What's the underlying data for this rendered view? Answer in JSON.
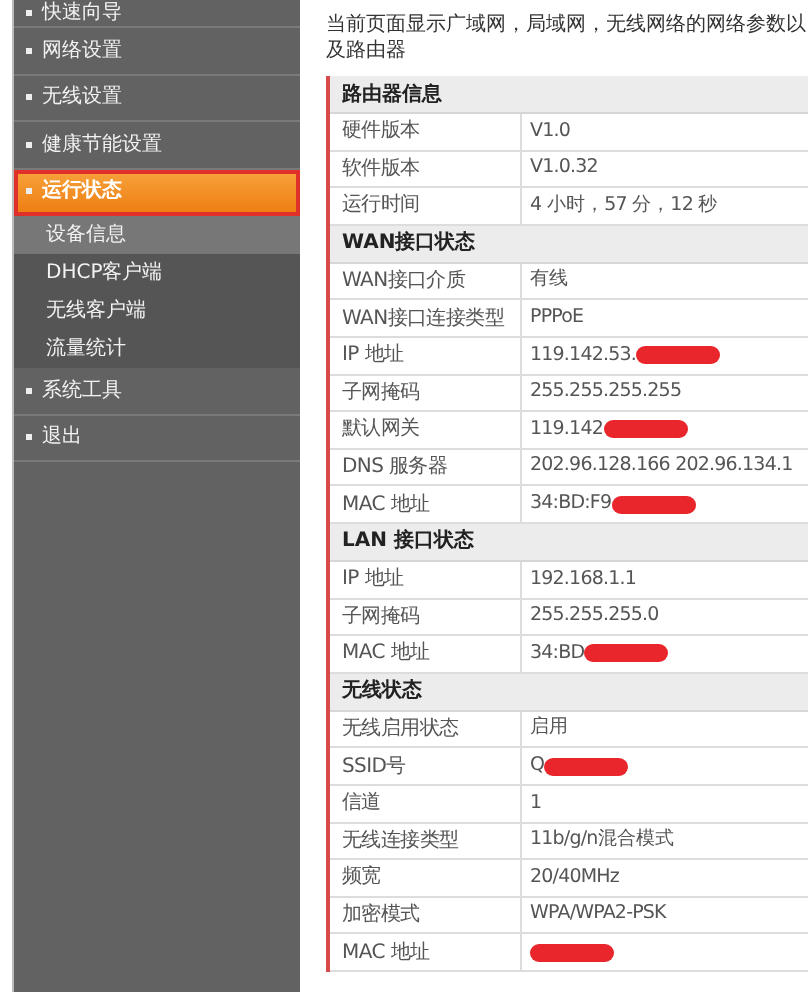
{
  "sidebar": {
    "items": [
      {
        "kind": "section",
        "label": "快速向导",
        "selected": false,
        "annotated": false
      },
      {
        "kind": "section",
        "label": "网络设置",
        "selected": false,
        "annotated": false
      },
      {
        "kind": "section",
        "label": "无线设置",
        "selected": false,
        "annotated": false
      },
      {
        "kind": "section",
        "label": "健康节能设置",
        "selected": false,
        "annotated": false
      },
      {
        "kind": "section",
        "label": "运行状态",
        "selected": true,
        "annotated": true
      },
      {
        "kind": "sub",
        "label": "设备信息",
        "selected": true,
        "annotated": false
      },
      {
        "kind": "sub",
        "label": "DHCP客户端",
        "selected": false,
        "annotated": false
      },
      {
        "kind": "sub",
        "label": "无线客户端",
        "selected": false,
        "annotated": false
      },
      {
        "kind": "sub",
        "label": "流量统计",
        "selected": false,
        "annotated": false
      },
      {
        "kind": "section",
        "label": "系统工具",
        "selected": false,
        "annotated": false
      },
      {
        "kind": "section",
        "label": "退出",
        "selected": false,
        "annotated": false
      }
    ]
  },
  "intro": "当前页面显示广域网，局域网，无线网络的网络参数以及路由器",
  "table": {
    "sections": [
      {
        "title": "路由器信息",
        "rows": [
          {
            "label": "硬件版本",
            "value": "V1.0",
            "redacted": false
          },
          {
            "label": "软件版本",
            "value": "V1.0.32",
            "redacted": false
          },
          {
            "label": "运行时间",
            "value": "4 小时，57 分，12 秒",
            "redacted": false
          }
        ]
      },
      {
        "title": "WAN接口状态",
        "rows": [
          {
            "label": "WAN接口介质",
            "value": "有线",
            "redacted": false
          },
          {
            "label": "WAN接口连接类型",
            "value": "PPPoE",
            "redacted": false
          },
          {
            "label": "IP 地址",
            "value": "119.142.53.",
            "redacted": true
          },
          {
            "label": "子网掩码",
            "value": "255.255.255.255",
            "redacted": false
          },
          {
            "label": "默认网关",
            "value": "119.142",
            "redacted": true
          },
          {
            "label": "DNS 服务器",
            "value": "202.96.128.166 202.96.134.1",
            "redacted": false
          },
          {
            "label": "MAC 地址",
            "value": "34:BD:F9",
            "redacted": true
          }
        ]
      },
      {
        "title": "LAN 接口状态",
        "rows": [
          {
            "label": "IP 地址",
            "value": "192.168.1.1",
            "redacted": false
          },
          {
            "label": "子网掩码",
            "value": "255.255.255.0",
            "redacted": false
          },
          {
            "label": "MAC 地址",
            "value": "34:BD",
            "redacted": true
          }
        ]
      },
      {
        "title": "无线状态",
        "rows": [
          {
            "label": "无线启用状态",
            "value": "启用",
            "redacted": false
          },
          {
            "label": "SSID号",
            "value": "Q",
            "redacted": true
          },
          {
            "label": "信道",
            "value": "1",
            "redacted": false
          },
          {
            "label": "无线连接类型",
            "value": "11b/g/n混合模式",
            "redacted": false
          },
          {
            "label": "频宽",
            "value": "20/40MHz",
            "redacted": false
          },
          {
            "label": "加密模式",
            "value": "WPA/WPA2-PSK",
            "redacted": false
          },
          {
            "label": "MAC 地址",
            "redacted": true
          }
        ]
      }
    ]
  }
}
